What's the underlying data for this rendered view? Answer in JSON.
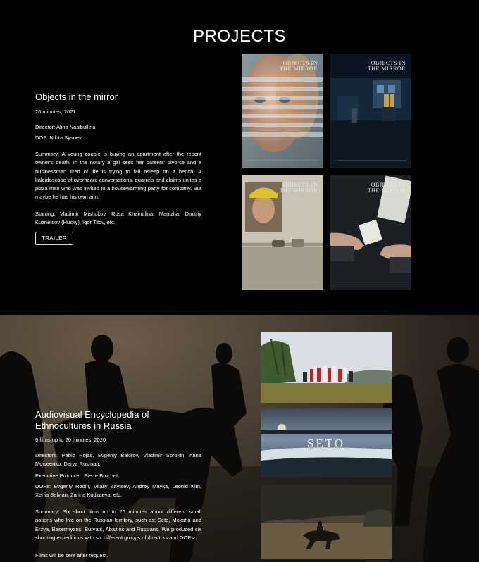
{
  "page": {
    "title": "PROJECTS"
  },
  "project1": {
    "title": "Objects in the mirror",
    "meta": "26 minutes, 2021",
    "director": "Director: Alina Nasibullina",
    "dop": "DOP: Nikita Sysoev",
    "summary": "Summary: A young couple is buying an apartment after the recent owner's death. In the notary a girl sees her parents' divorce and a businessman tired of life is trying to fall asleep on a bench. A kaleidoscope of overheard conversations, quarrels and claims unites a pizza man who was invited to a housewarming party for company. But maybe he has his own aim.",
    "starring": "Starring: Vladimir Mishukov, Rosa Khairullina, Manizha, Dmitriy Kuznetsov (Husky), Igor Titov, etc.",
    "trailer_label": "TRAILER",
    "poster_title_line1": "Objects in",
    "poster_title_line2": "the mirror"
  },
  "project2": {
    "title": "Audiovisual Encyclopedia of Ethnocultures in Russia",
    "meta": "6 films up to 26 minutes, 2020",
    "directors": "Directors: Pablo Rojas, Evgeniy Bakirov, Vladimir Sorokin, Anna Moiseenko, Darya Rusman.",
    "producer": "Executive Producer: Pierre Brochet.",
    "dops": "DOPs: Evgeniy Rodin, Vitaliy Zaytsev, Andrey Mayka, Leonid Kim, Xenia Selvian, Zarina Kodzaeva, etc.",
    "summary": "Summary: Six short films up to 26 minutes about different small nations who live on the Russian territory, such as: Seto, Moksha and Erzya, Besermyans, Buryats, Abazins and Russians. We produced six shooting expeditions with six different groups of directors and DOPs.",
    "note": "Films will be sent after request.",
    "seto_title": "SETO"
  }
}
